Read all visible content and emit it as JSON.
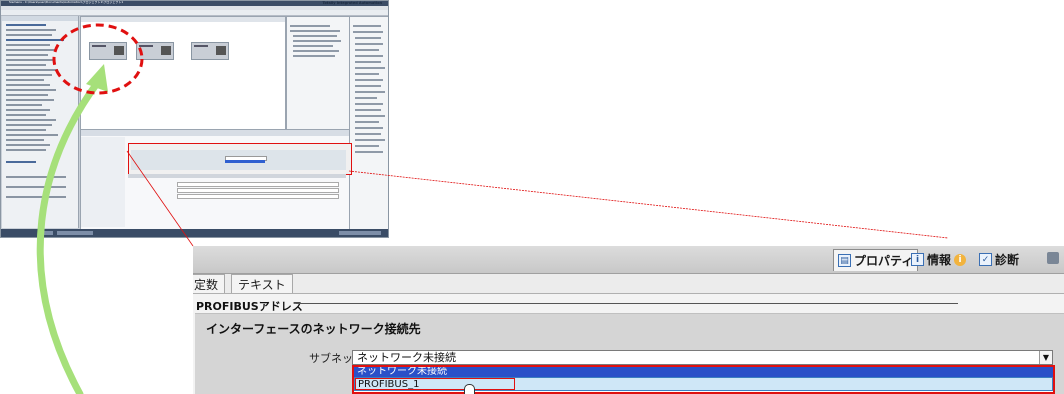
{
  "thumbnail": {
    "title_text": "Siemens - C:\\Users\\user\\Documents\\Automation\\プロジェクト1\\プロジェクト1",
    "brand_text": "Totally Integrated Automation"
  },
  "properties_tabs": [
    {
      "label": "プロパティ",
      "icon": "properties-icon",
      "active": true
    },
    {
      "label": "情報",
      "icon": "info-icon",
      "active": false
    },
    {
      "label": "診断",
      "icon": "diagnostics-icon",
      "active": false
    }
  ],
  "info_badge": "i",
  "sub_tabs": [
    {
      "label": "定数"
    },
    {
      "label": "テキスト"
    }
  ],
  "section_title": "PROFIBUSアドレス",
  "group_title": "インターフェースのネットワーク接続先",
  "subnet": {
    "label": "サブネット:",
    "value": "ネットワーク未接続",
    "dropdown_options": [
      "ネットワーク未接続",
      "PROFIBUS_1"
    ]
  },
  "colors": {
    "highlight_red": "#e01010",
    "arrow_green": "#a6e07a",
    "selection_blue": "#2a50c8",
    "hover_light_blue": "#cfe7f7"
  }
}
